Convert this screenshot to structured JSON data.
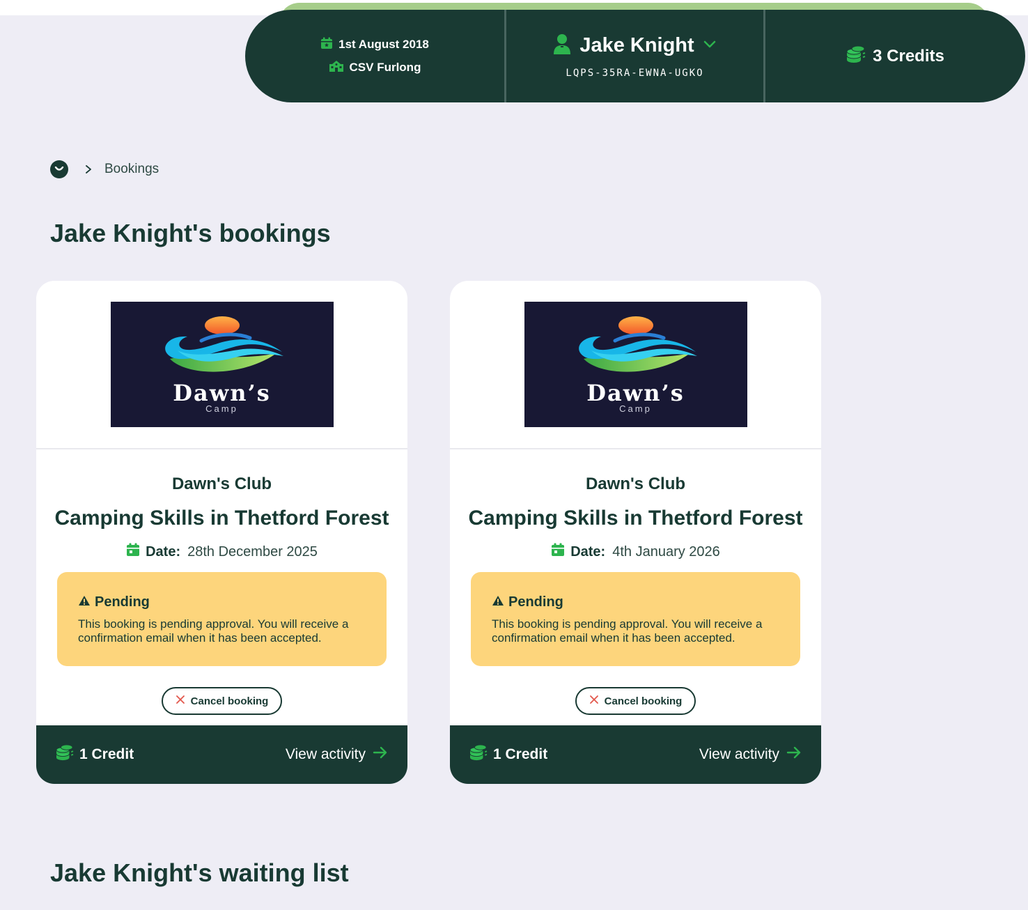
{
  "header": {
    "date": "1st August 2018",
    "organisation": "CSV Furlong",
    "user_name": "Jake Knight",
    "user_code": "LQPS-35RA-EWNA-UGKO",
    "credits": "3 Credits"
  },
  "breadcrumb": {
    "current": "Bookings"
  },
  "page_title": "Jake Knight's bookings",
  "bookings": [
    {
      "logo_title": "Dawn’s",
      "logo_subtitle": "Camp",
      "club": "Dawn's Club",
      "activity": "Camping Skills in Thetford Forest",
      "date_label": "Date:",
      "date": "28th December 2025",
      "status_title": "Pending",
      "status_text": "This booking is pending approval. You will receive a confirmation email when it has been accepted.",
      "cancel_label": "Cancel booking",
      "credit": "1 Credit",
      "view_label": "View activity"
    },
    {
      "logo_title": "Dawn’s",
      "logo_subtitle": "Camp",
      "club": "Dawn's Club",
      "activity": "Camping Skills in Thetford Forest",
      "date_label": "Date:",
      "date": "4th January 2026",
      "status_title": "Pending",
      "status_text": "This booking is pending approval. You will receive a confirmation email when it has been accepted.",
      "cancel_label": "Cancel booking",
      "credit": "1 Credit",
      "view_label": "View activity"
    }
  ],
  "waiting_list_title": "Jake Knight's waiting list",
  "colors": {
    "brand_dark": "#193a33",
    "accent_green": "#2db44e",
    "pending_bg": "#fdd57c",
    "page_bg": "#eeedf5",
    "cancel_x": "#e2574c"
  },
  "icons": {
    "date": "calendar-icon",
    "organisation": "school-icon",
    "user": "user-icon",
    "dropdown": "chevron-down-icon",
    "credits": "coins-icon",
    "home": "smile-icon",
    "separator": "chevron-right-icon",
    "warning": "warning-icon",
    "cancel": "close-icon",
    "arrow": "arrow-right-icon"
  }
}
